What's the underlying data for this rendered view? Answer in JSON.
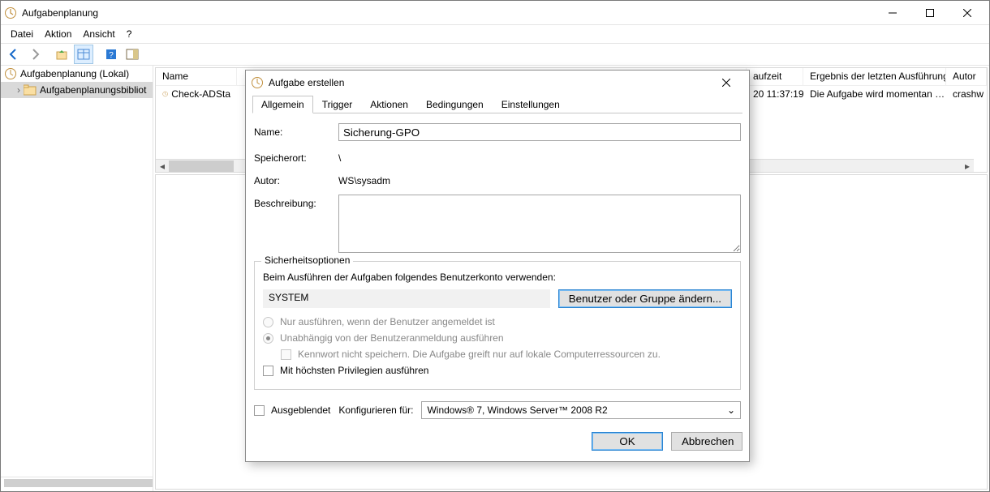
{
  "window": {
    "title": "Aufgabenplanung"
  },
  "menu": {
    "file": "Datei",
    "action": "Aktion",
    "view": "Ansicht",
    "help": "?"
  },
  "tree": {
    "root": "Aufgabenplanung (Lokal)",
    "lib": "Aufgabenplanungsbibliot"
  },
  "list": {
    "col_name": "Name",
    "col_time": "aufzeit",
    "col_result": "Ergebnis der letzten Ausführung",
    "col_author": "Autor",
    "row": {
      "name": "Check-ADSta",
      "time": "20 11:37:19",
      "result": "Die Aufgabe wird momentan …",
      "author": "crashw"
    }
  },
  "dialog": {
    "title": "Aufgabe erstellen",
    "tabs": {
      "general": "Allgemein",
      "trigger": "Trigger",
      "actions": "Aktionen",
      "conditions": "Bedingungen",
      "settings": "Einstellungen"
    },
    "label_name": "Name:",
    "value_name": "Sicherung-GPO",
    "label_location": "Speicherort:",
    "value_location": "\\",
    "label_author": "Autor:",
    "value_author": "WS\\sysadm",
    "label_description": "Beschreibung:",
    "sec_group": "Sicherheitsoptionen",
    "sec_text": "Beim Ausführen der Aufgaben folgendes Benutzerkonto verwenden:",
    "sec_account": "SYSTEM",
    "btn_change_user": "Benutzer oder Gruppe ändern...",
    "opt_logged": "Nur ausführen, wenn der Benutzer angemeldet ist",
    "opt_anytime": "Unabhängig von der Benutzeranmeldung ausführen",
    "opt_nopw": "Kennwort nicht speichern. Die Aufgabe greift nur auf lokale Computerressourcen zu.",
    "opt_priv": "Mit höchsten Privilegien ausführen",
    "opt_hidden": "Ausgeblendet",
    "label_config": "Konfigurieren für:",
    "value_config": "Windows® 7, Windows Server™ 2008 R2",
    "btn_ok": "OK",
    "btn_cancel": "Abbrechen"
  }
}
